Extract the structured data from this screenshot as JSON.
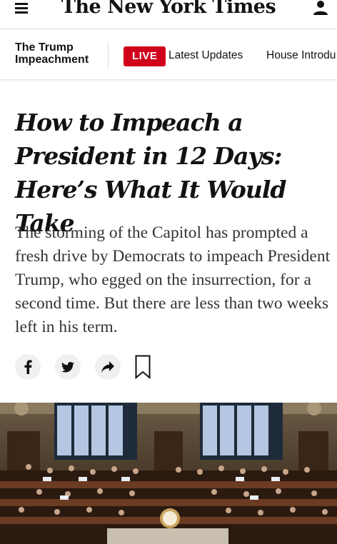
{
  "masthead": {
    "logo_text": "The New York Times",
    "menu_icon": "hamburger-menu-icon",
    "account_icon": "account-icon"
  },
  "section_bar": {
    "title_line1": "The Trump",
    "title_line2": "Impeachment",
    "live_label": "LIVE",
    "links": [
      "Latest Updates",
      "House Introdu"
    ],
    "live_color": "#d0021b"
  },
  "article": {
    "headline": "How to Impeach a President in 12 Days: Here’s What It Would Take",
    "summary": "The storming of the Capitol has prompted a fresh drive by Democrats to impeach President Trump, who egged on the insurrection, for a second time. But there are less than two weeks left in his term."
  },
  "share": {
    "facebook_icon": "facebook-icon",
    "twitter_icon": "twitter-icon",
    "share_icon": "share-arrow-icon",
    "bookmark_icon": "bookmark-icon"
  },
  "photo": {
    "description_icon": "house-chamber-photo"
  }
}
